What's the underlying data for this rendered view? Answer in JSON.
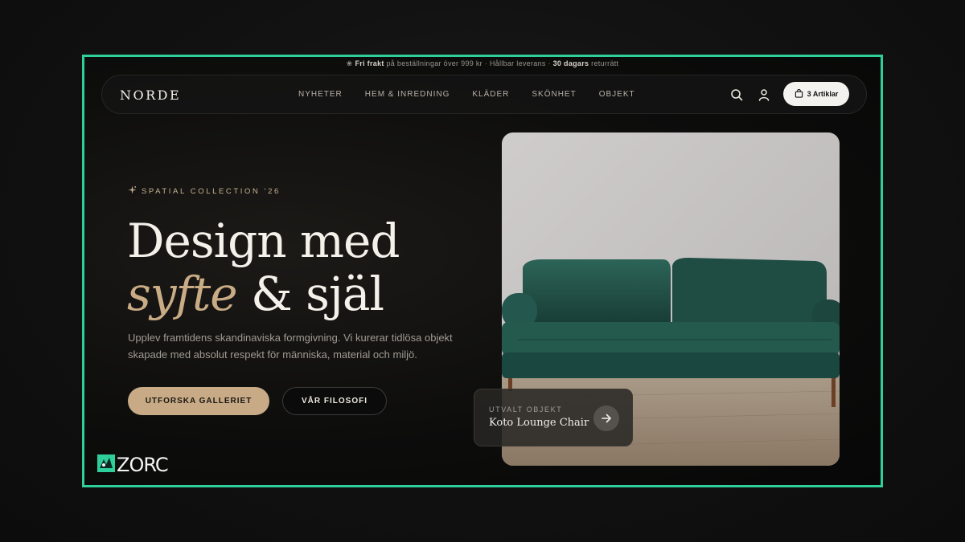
{
  "announcement": {
    "part1_bold": "Fri frakt",
    "part2": " på beställningar över 999 kr · Hållbar leverans · ",
    "part3_bold": "30 dagars",
    "part4": " returrätt"
  },
  "nav": {
    "brand": "NORDE",
    "items": [
      "NYHETER",
      "HEM & INREDNING",
      "KLÄDER",
      "SKÖNHET",
      "OBJEKT"
    ],
    "cart_label": "3 Artiklar"
  },
  "hero": {
    "kicker": "SPATIAL COLLECTION '26",
    "headline_line1": "Design med",
    "headline_accent": "syfte",
    "headline_rest": " & själ",
    "lead": "Upplev framtidens skandinaviska formgivning. Vi kurerar tidlösa objekt skapade med absolut respekt för människa, material och miljö.",
    "primary_button": "UTFORSKA GALLERIET",
    "secondary_button": "VÅR FILOSOFI"
  },
  "featured": {
    "label": "UTVALT OBJEKT",
    "name": "Koto Lounge Chair"
  },
  "watermark": {
    "text": "ZORC"
  },
  "colors": {
    "accent_frame": "#2ecf9a",
    "gold": "#c8ab86",
    "sofa": "#1f4d45"
  },
  "icons": [
    "leaf-icon",
    "sparkle-icon",
    "search-icon",
    "user-icon",
    "bag-icon",
    "arrow-right-icon",
    "zorc-logo-icon"
  ]
}
